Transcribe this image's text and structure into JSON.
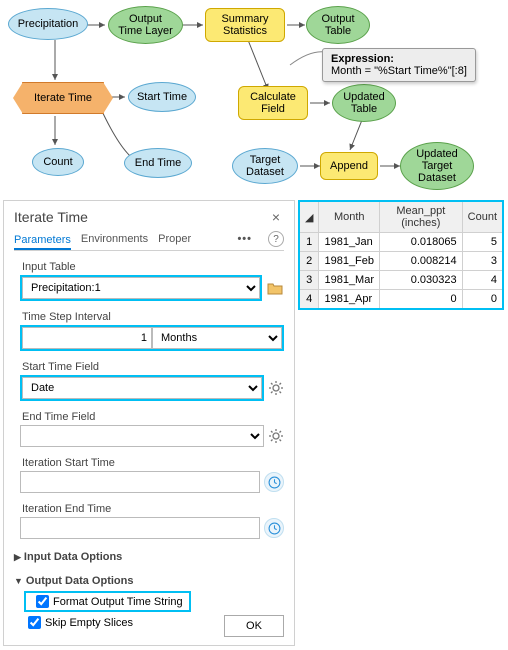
{
  "flowchart": {
    "precipitation": "Precipitation",
    "output_time_layer": "Output\nTime Layer",
    "summary_stats": "Summary\nStatistics",
    "output_table": "Output\nTable",
    "iterate_time": "Iterate Time",
    "start_time": "Start Time",
    "calculate_field": "Calculate\nField",
    "updated_table": "Updated\nTable",
    "count": "Count",
    "end_time": "End Time",
    "target_dataset": "Target\nDataset",
    "append": "Append",
    "updated_target": "Updated\nTarget\nDataset",
    "tooltip_title": "Expression:",
    "tooltip_body": "Month = \"%Start Time%\"[:8]"
  },
  "panel": {
    "title": "Iterate Time",
    "tabs": {
      "parameters": "Parameters",
      "environments": "Environments",
      "properties": "Proper"
    },
    "input_table_label": "Input Table",
    "input_table_value": "Precipitation:1",
    "time_step_label": "Time Step Interval",
    "time_step_number": "1",
    "time_step_unit": "Months",
    "start_time_field_label": "Start Time Field",
    "start_time_field_value": "Date",
    "end_time_field_label": "End Time Field",
    "end_time_field_value": "",
    "iter_start_label": "Iteration Start Time",
    "iter_start_value": "",
    "iter_end_label": "Iteration End Time",
    "iter_end_value": "",
    "input_data_options": "Input Data Options",
    "output_data_options": "Output Data Options",
    "format_output": "Format Output Time String",
    "skip_empty": "Skip Empty Slices",
    "ok": "OK"
  },
  "table": {
    "headers": {
      "month": "Month",
      "mean": "Mean_ppt (inches)",
      "count": "Count"
    },
    "rows": [
      {
        "n": "1",
        "month": "1981_Jan",
        "mean": "0.018065",
        "count": "5"
      },
      {
        "n": "2",
        "month": "1981_Feb",
        "mean": "0.008214",
        "count": "3"
      },
      {
        "n": "3",
        "month": "1981_Mar",
        "mean": "0.030323",
        "count": "4"
      },
      {
        "n": "4",
        "month": "1981_Apr",
        "mean": "0",
        "count": "0"
      }
    ]
  }
}
